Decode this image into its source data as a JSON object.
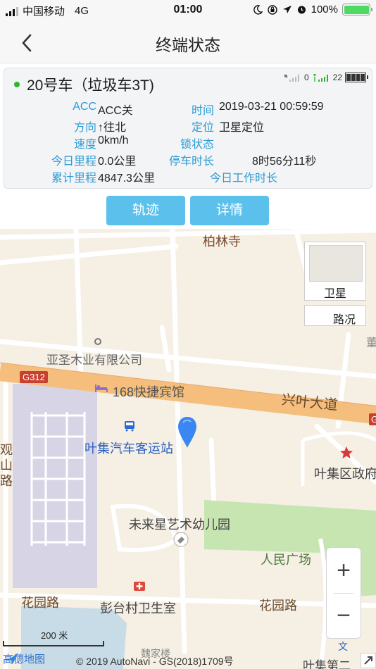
{
  "status_bar": {
    "carrier": "中国移动",
    "network": "4G",
    "time": "01:00",
    "battery": "100%"
  },
  "header": {
    "title": "终端状态",
    "back_icon": "chevron-left-icon"
  },
  "card": {
    "vehicle": "20号车（垃圾车3T)",
    "online_color": "#2db52d",
    "gps_count": "0",
    "signal_count": "22",
    "fields": {
      "acc_label": "ACC",
      "acc_value": "ACC关",
      "time_label": "时间",
      "time_value": "2019-03-21 00:59:59",
      "direction_label": "方向",
      "direction_value": "↑往北",
      "position_label": "定位",
      "position_value": "卫星定位",
      "speed_label": "速度",
      "speed_value": "0km/h",
      "lock_label": "锁状态",
      "lock_value": "",
      "today_mileage_label": "今日里程",
      "today_mileage_value": "0.0公里",
      "stop_label": "停车时长",
      "stop_value": "8时56分11秒",
      "total_mileage_label": "累计里程",
      "total_mileage_value": "4847.3公里",
      "work_label": "今日工作时长",
      "work_value": ""
    }
  },
  "actions": {
    "track": "轨迹",
    "detail": "详情",
    "accent": "#5cc0ec",
    "label_color": "#2b9bd6"
  },
  "map": {
    "labels": {
      "bailin": "柏林寺",
      "yasheng": "亚圣木业有限公司",
      "g312": "G312",
      "g_right": "G",
      "hotel": "168快捷宾馆",
      "xingye": "兴叶大道",
      "station": "叶集汽车客运站",
      "guan": "观",
      "shan": "山",
      "lu": "路",
      "gov": "叶集区政府",
      "kindergarten": "未来星艺术幼儿园",
      "square": "人民广场",
      "huayuan_left": "花园路",
      "huayuan_right": "花园路",
      "clinic": "彭台村卫生室",
      "scale": "200 米",
      "edge_right": "董",
      "edge_bottom": "魏家楼",
      "copyright": "© 2019 AutoNavi - GS(2018)1709号",
      "amap": "高德地图",
      "bottom_right": "叶集第二",
      "wen": "文"
    },
    "layers": {
      "satellite": "卫星",
      "traffic": "路况"
    },
    "zoom": {
      "in": "+",
      "out": "−"
    }
  }
}
